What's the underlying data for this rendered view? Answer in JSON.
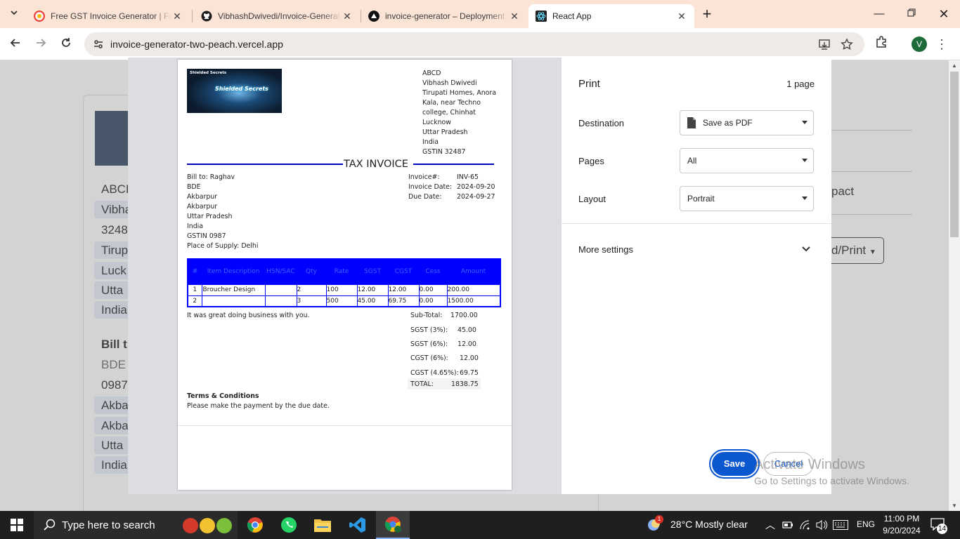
{
  "browser": {
    "tabs": [
      {
        "title": "Free GST Invoice Generator | Free Invoice Maker",
        "icon": "google-docs-icon"
      },
      {
        "title": "VibhashDwivedi/Invoice-Generator",
        "icon": "github-icon"
      },
      {
        "title": "invoice-generator – Deployment",
        "icon": "vercel-icon"
      },
      {
        "title": "React App",
        "icon": "react-icon"
      }
    ],
    "new_tab": "+",
    "url": "invoice-generator-two-peach.vercel.app",
    "profile_initial": "V"
  },
  "background_page": {
    "company": "ABCD",
    "name": "Vibhash",
    "gstin_partial": "3248",
    "addr_lines": [
      "Tirup",
      "Luck",
      "Utta",
      "India"
    ],
    "bill_to_heading": "Bill t",
    "bill_name": "BDE",
    "bill_gst": "0987",
    "bill_lines": [
      "Akba",
      "Akba",
      "Utta",
      "India"
    ],
    "layout_option": "pact",
    "download_button": "d/Print"
  },
  "invoice": {
    "logo_text": "Shielded Secrets",
    "seller": [
      "ABCD",
      "Vibhash Dwivedi",
      "Tirupati Homes, Anora",
      "Kala, near Techno",
      "college, Chinhat",
      "Lucknow",
      "Uttar Pradesh",
      "India",
      "GSTIN 32487"
    ],
    "title": "TAX INVOICE",
    "bill_to": [
      "Bill to: Raghav",
      "BDE",
      "Akbarpur",
      "Akbarpur",
      "Uttar Pradesh",
      "India",
      "GSTIN 0987",
      "Place of Supply: Delhi"
    ],
    "meta": {
      "labels": [
        "Invoice#:",
        "Invoice Date:",
        "Due Date:"
      ],
      "values": [
        "INV-65",
        "2024-09-20",
        "2024-09-27"
      ]
    },
    "table": {
      "headers": [
        "#",
        "Item Description",
        "HSN/SAC",
        "Qty",
        "Rate",
        "SGST",
        "CGST",
        "Cess",
        "Amount"
      ],
      "rows": [
        [
          "1",
          "Broucher Design",
          "",
          "2",
          "100",
          "12.00",
          "12.00",
          "0.00",
          "200.00"
        ],
        [
          "2",
          "",
          "",
          "3",
          "500",
          "45.00",
          "69.75",
          "0.00",
          "1500.00"
        ]
      ]
    },
    "thanks": "It was great doing business with you.",
    "totals": [
      {
        "label": "Sub-Total:",
        "value": "1700.00"
      },
      {
        "label": "SGST (3%):",
        "value": "45.00"
      },
      {
        "label": "SGST (6%):",
        "value": "12.00"
      },
      {
        "label": "CGST (6%):",
        "value": "12.00"
      },
      {
        "label": "CGST (4.65%):",
        "value": "69.75"
      },
      {
        "label": "TOTAL:",
        "value": "1838.75"
      }
    ],
    "terms_heading": "Terms & Conditions",
    "terms_text": "Please make the payment by the due date."
  },
  "print": {
    "title": "Print",
    "page_count": "1 page",
    "destination_label": "Destination",
    "destination_value": "Save as PDF",
    "pages_label": "Pages",
    "pages_value": "All",
    "layout_label": "Layout",
    "layout_value": "Portrait",
    "more_settings": "More settings",
    "save": "Save",
    "cancel": "Cancel"
  },
  "watermark": {
    "line1": "Activate Windows",
    "line2": "Go to Settings to activate Windows."
  },
  "taskbar": {
    "search_placeholder": "Type here to search",
    "weather": "28°C  Mostly clear",
    "lang": "ENG",
    "time": "11:00 PM",
    "date": "9/20/2024",
    "notifications": "14",
    "chrome_badge": "1"
  },
  "colors": {
    "tabstrip": "#fbe3d6",
    "accent_blue": "#0b57d0",
    "table_blue": "#0000ff",
    "title_rule": "#0000c0"
  }
}
